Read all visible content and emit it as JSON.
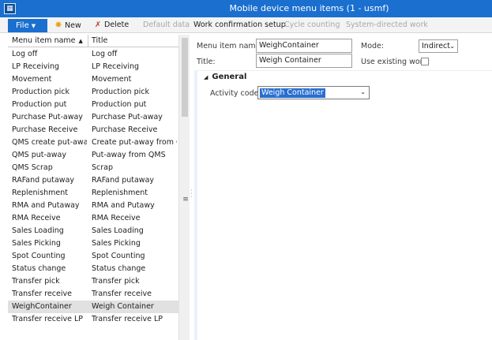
{
  "window": {
    "title": "Mobile device menu items (1 - usmf)",
    "icon": "app-icon"
  },
  "toolbar": {
    "file_label": "File",
    "new_label": "New",
    "delete_label": "Delete",
    "default_data_label": "Default data",
    "work_confirmation_label": "Work confirmation setup",
    "cycle_counting_label": "Cycle counting",
    "system_directed_label": "System-directed work"
  },
  "list": {
    "col1_header": "Menu item name",
    "col2_header": "Title",
    "rows": [
      {
        "name": "Log off",
        "title": "Log off"
      },
      {
        "name": "LP Receiving",
        "title": "LP Receiving"
      },
      {
        "name": "Movement",
        "title": "Movement"
      },
      {
        "name": "Production pick",
        "title": "Production pick"
      },
      {
        "name": "Production put",
        "title": "Production put"
      },
      {
        "name": "Purchase Put-away",
        "title": "Purchase Put-away"
      },
      {
        "name": "Purchase Receive",
        "title": "Purchase Receive"
      },
      {
        "name": "QMS create put-away",
        "title": "Create put-away from QMS"
      },
      {
        "name": "QMS put-away",
        "title": "Put-away from QMS"
      },
      {
        "name": "QMS Scrap",
        "title": "Scrap"
      },
      {
        "name": "RAFand putaway",
        "title": "RAFand putaway"
      },
      {
        "name": "Replenishment",
        "title": "Replenishment"
      },
      {
        "name": "RMA and Putaway",
        "title": "RMA and Putawy"
      },
      {
        "name": "RMA Receive",
        "title": "RMA Receive"
      },
      {
        "name": "Sales Loading",
        "title": "Sales Loading"
      },
      {
        "name": "Sales Picking",
        "title": "Sales Picking"
      },
      {
        "name": "Spot Counting",
        "title": "Spot Counting"
      },
      {
        "name": "Status change",
        "title": "Status change"
      },
      {
        "name": "Transfer pick",
        "title": "Transfer pick"
      },
      {
        "name": "Transfer receive",
        "title": "Transfer receive"
      },
      {
        "name": "WeighContainer",
        "title": "Weigh Container"
      },
      {
        "name": "Transfer receive LP",
        "title": "Transfer receive LP"
      }
    ],
    "selected_index": 20
  },
  "detail": {
    "menu_item_name_label": "Menu item name:",
    "menu_item_name_value": "WeighContainer",
    "title_label": "Title:",
    "title_value": "Weigh Container",
    "mode_label": "Mode:",
    "mode_value": "Indirect",
    "use_existing_work_label": "Use existing work:",
    "use_existing_work_checked": false,
    "general_section_label": "General",
    "activity_code_label": "Activity code:",
    "activity_code_value": "Weigh Container"
  }
}
